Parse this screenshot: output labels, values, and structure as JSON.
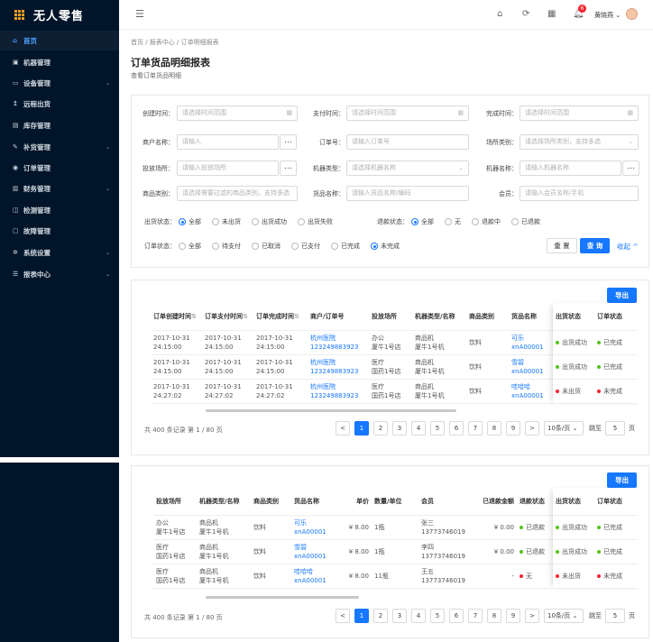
{
  "app": {
    "title": "无人零售"
  },
  "sidebar": {
    "items": [
      {
        "icon": "home-icon",
        "glyph": "⌂",
        "label": "首页",
        "arrow": ""
      },
      {
        "icon": "vending-machine-icon",
        "glyph": "▣",
        "label": "机器管理",
        "arrow": ""
      },
      {
        "icon": "device-icon",
        "glyph": "▭",
        "label": "设备管理",
        "arrow": "⌄"
      },
      {
        "icon": "remote-out-icon",
        "glyph": "↥",
        "label": "远程出货",
        "arrow": ""
      },
      {
        "icon": "stock-icon",
        "glyph": "▤",
        "label": "库存管理",
        "arrow": ""
      },
      {
        "icon": "restock-icon",
        "glyph": "✎",
        "label": "补货管理",
        "arrow": "⌄"
      },
      {
        "icon": "order-icon",
        "glyph": "◉",
        "label": "订单管理",
        "arrow": ""
      },
      {
        "icon": "finance-icon",
        "glyph": "▥",
        "label": "财务管理",
        "arrow": "⌄"
      },
      {
        "icon": "inspect-icon",
        "glyph": "◫",
        "label": "检测管理",
        "arrow": ""
      },
      {
        "icon": "fault-icon",
        "glyph": "▢",
        "label": "故障管理",
        "arrow": ""
      },
      {
        "icon": "settings-icon",
        "glyph": "✲",
        "label": "系统设置",
        "arrow": "⌄"
      },
      {
        "icon": "report-icon",
        "glyph": "☰",
        "label": "报表中心",
        "arrow": "⌄"
      }
    ]
  },
  "header": {
    "menu_glyph": "☰",
    "badge": "6",
    "user": "黄晓燕 ⌄"
  },
  "breadcrumb": "首页  /  报表中心  /  订单明细报表",
  "page": {
    "title": "订单货品明细报表",
    "subtitle": "查看订单货品明细"
  },
  "filters": {
    "create_time": {
      "label": "创建时间：",
      "placeholder": "请选择时间范围"
    },
    "pay_time": {
      "label": "支付时间：",
      "placeholder": "请选择时间范围"
    },
    "done_time": {
      "label": "完成时间：",
      "placeholder": "请选择时间范围"
    },
    "merchant": {
      "label": "商户名称：",
      "placeholder": "请输入"
    },
    "order_no": {
      "label": "订单号：",
      "placeholder": "请输入订单号"
    },
    "venue_type": {
      "label": "场所类别：",
      "placeholder": "请选择场所类别，支持多选"
    },
    "venue": {
      "label": "投放场所：",
      "placeholder": "请输入投放场所"
    },
    "machine_type": {
      "label": "机器类型：",
      "placeholder": "请选择机器名称"
    },
    "machine_name": {
      "label": "机器名称：",
      "placeholder": "请输入机器名称"
    },
    "goods_type": {
      "label": "商品类别：",
      "placeholder": "请选择需要过滤的商品类别，支持多选"
    },
    "goods_name": {
      "label": "货品名称：",
      "placeholder": "请输入货品名称/编码"
    },
    "member": {
      "label": "会员：",
      "placeholder": "请输入会员名称/手机"
    },
    "ship_status": {
      "label": "出货状态：",
      "options": [
        "全部",
        "未出货",
        "出货成功",
        "出货失败"
      ],
      "selected": 0
    },
    "refund_status": {
      "label": "退款状态：",
      "options": [
        "全部",
        "无",
        "退款中",
        "已退款"
      ],
      "selected": 0
    },
    "order_status": {
      "label": "订单状态：",
      "options": [
        "全部",
        "待支付",
        "已取消",
        "已支付",
        "已完成",
        "未完成"
      ],
      "selected": 5
    },
    "reset": "重 置",
    "query": "查 询",
    "collapse": "收起"
  },
  "export_label": "导出",
  "table1": {
    "headers": [
      "订单创建时间",
      "订单支付时间",
      "订单完成时间",
      "商户/订单号",
      "投放场所",
      "机器类型/名称",
      "商品类别",
      "货品名称"
    ],
    "fixed_headers": [
      "出货状态",
      "订单状态"
    ],
    "rows": [
      {
        "c": [
          "2017-10-31",
          "2017-10-31",
          "2017-10-31"
        ],
        "t": [
          "24:15:00",
          "24:15:00",
          "24:15:00"
        ],
        "m": [
          "杭州医院",
          "123249883923"
        ],
        "v": [
          "办公",
          "厦牛1号店"
        ],
        "mt": [
          "商品机",
          "厦牛1号机"
        ],
        "g": "饮料",
        "n": [
          "可乐",
          "xnA00001"
        ],
        "s": "出货成功",
        "o": "已完成",
        "sc": "#52c41a",
        "oc": "#52c41a"
      },
      {
        "c": [
          "2017-10-31",
          "2017-10-31",
          "2017-10-31"
        ],
        "t": [
          "24:15:00",
          "24:15:00",
          "24:15:00"
        ],
        "m": [
          "杭州医院",
          "123249883923"
        ],
        "v": [
          "医疗",
          "国药1号店"
        ],
        "mt": [
          "商品机",
          "厦牛1号机"
        ],
        "g": "饮料",
        "n": [
          "雪碧",
          "xnA00001"
        ],
        "s": "出货成功",
        "o": "已完成",
        "sc": "#52c41a",
        "oc": "#52c41a"
      },
      {
        "c": [
          "2017-10-31",
          "2017-10-31",
          "2017-10-31"
        ],
        "t": [
          "24:27:02",
          "24:27:02",
          "24:27:02"
        ],
        "m": [
          "杭州医院",
          "123249883923"
        ],
        "v": [
          "医疗",
          "国药1号店"
        ],
        "mt": [
          "商品机",
          "厦牛1号机"
        ],
        "g": "饮料",
        "n": [
          "哇哈哈",
          "xnA00001"
        ],
        "s": "未出货",
        "o": "未完成",
        "sc": "#f5222d",
        "oc": "#f5222d"
      }
    ]
  },
  "table2": {
    "headers": [
      "投放场所",
      "机器类型/名称",
      "商品类别",
      "货品名称",
      "单价",
      "数量/单位",
      "会员",
      "已退款金额",
      "退款状态"
    ],
    "fixed_headers": [
      "出货状态",
      "订单状态"
    ],
    "rows": [
      {
        "v": [
          "办公",
          "厦牛1号店"
        ],
        "mt": [
          "商品机",
          "厦牛1号机"
        ],
        "g": "饮料",
        "n": [
          "可乐",
          "xnA00001"
        ],
        "p": "¥ 8.00",
        "q": "1瓶",
        "mb": [
          "张三",
          "13773746019"
        ],
        "r": "¥ 0.00",
        "rs": "已退款",
        "rc": "#52c41a",
        "s": "出货成功",
        "o": "已完成",
        "sc": "#52c41a",
        "oc": "#52c41a"
      },
      {
        "v": [
          "医疗",
          "国药1号店"
        ],
        "mt": [
          "商品机",
          "厦牛1号机"
        ],
        "g": "饮料",
        "n": [
          "雪碧",
          "xnA00001"
        ],
        "p": "¥ 8.00",
        "q": "1瓶",
        "mb": [
          "李四",
          "13773746019"
        ],
        "r": "¥ 0.00",
        "rs": "已退款",
        "rc": "#52c41a",
        "s": "出货成功",
        "o": "已完成",
        "sc": "#52c41a",
        "oc": "#52c41a"
      },
      {
        "v": [
          "医疗",
          "国药1号店"
        ],
        "mt": [
          "商品机",
          "厦牛1号机"
        ],
        "g": "饮料",
        "n": [
          "哇哈哈",
          "xnA00001"
        ],
        "p": "¥ 8.00",
        "q": "11瓶",
        "mb": [
          "王五",
          "13773746019"
        ],
        "r": "-",
        "rs": "无",
        "rc": "#f5222d",
        "s": "未出货",
        "o": "未完成",
        "sc": "#f5222d",
        "oc": "#f5222d"
      }
    ]
  },
  "pagination": {
    "total": "共 400 条记录 第 1 / 80 页",
    "prev": "<",
    "next": ">",
    "pages": [
      "1",
      "2",
      "3",
      "4",
      "5",
      "6",
      "7",
      "8",
      "9"
    ],
    "page_size": "10条/页 ⌄",
    "jump_label": "跳至",
    "jump_value": "5",
    "jump_unit": "页"
  },
  "colors": {
    "accent": "#1677ff",
    "success": "#52c41a",
    "danger": "#f5222d",
    "sidebar": "#001529"
  }
}
